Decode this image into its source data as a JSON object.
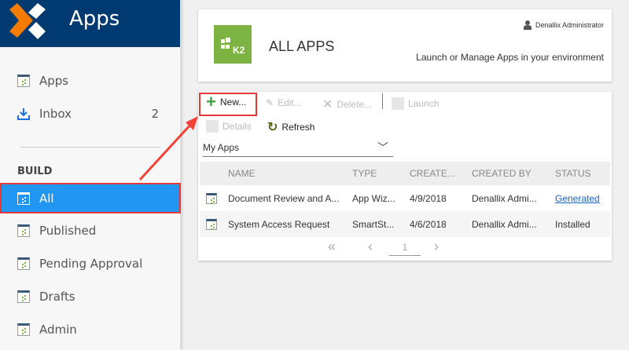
{
  "app_title": "Apps",
  "colors": {
    "header": "#003a70",
    "accent": "#2196f3",
    "highlight": "#e53935",
    "brand_green": "#7cb342"
  },
  "sidebar": {
    "items": [
      {
        "label": "Apps",
        "icon": "app-icon"
      },
      {
        "label": "Inbox",
        "icon": "inbox-download-icon",
        "count": "2"
      }
    ],
    "section": "BUILD",
    "build_items": [
      {
        "label": "All",
        "active": true
      },
      {
        "label": "Published"
      },
      {
        "label": "Pending Approval"
      },
      {
        "label": "Drafts"
      },
      {
        "label": "Admin"
      }
    ]
  },
  "header": {
    "logo_text": "K2",
    "title": "ALL APPS",
    "user": "Denallix Administrator",
    "subtitle": "Launch or Manage Apps in your environment"
  },
  "toolbar": {
    "new": "New...",
    "edit": "Edit...",
    "delete": "Delete...",
    "launch": "Launch",
    "details": "Details",
    "refresh": "Refresh"
  },
  "filter": {
    "selected": "My Apps"
  },
  "table": {
    "columns": [
      "NAME",
      "TYPE",
      "CREATE...",
      "CREATED BY",
      "STATUS"
    ],
    "rows": [
      {
        "name": "Document Review and A...",
        "type": "App Wiz...",
        "created": "4/9/2018",
        "created_by": "Denallix Admi...",
        "status": "Generated"
      },
      {
        "name": "System Access Request",
        "type": "SmartSt...",
        "created": "4/6/2018",
        "created_by": "Denallix Admi...",
        "status": "Installed"
      }
    ]
  },
  "pager": {
    "page": "1"
  }
}
